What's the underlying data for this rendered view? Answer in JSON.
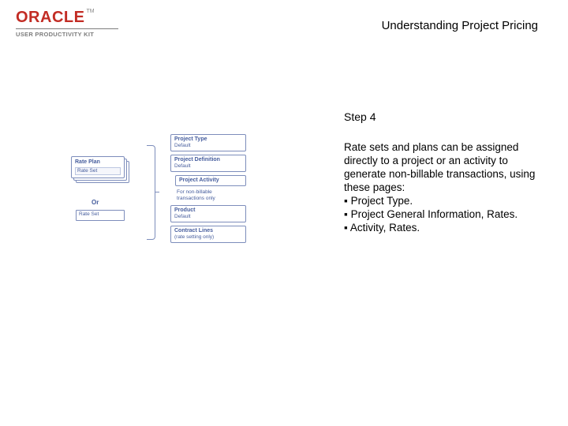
{
  "header": {
    "brand": "ORACLE",
    "tm": "TM",
    "subtitle": "USER PRODUCTIVITY KIT",
    "page_title": "Understanding Project Pricing"
  },
  "step": {
    "label": "Step 4"
  },
  "body": {
    "intro": "Rate sets and plans can be assigned directly to a project or an activity to generate non-billable transactions, using these pages:",
    "bullets": [
      "Project Type.",
      "Project General Information, Rates.",
      "Activity, Rates."
    ],
    "bullet_glyph": "▪"
  },
  "diagram": {
    "left_card_title": "Rate Plan",
    "left_card_row": "Rate Set",
    "or": "Or",
    "left_single": "Rate Set",
    "right_nodes": [
      {
        "title": "Project Type",
        "sub": "Default",
        "indent": false
      },
      {
        "title": "Project Definition",
        "sub": "Default",
        "indent": false
      },
      {
        "title": "Project Activity",
        "sub": "",
        "indent": true
      }
    ],
    "note_lines": [
      "For non-billable",
      "transactions only"
    ],
    "right_nodes2": [
      {
        "title": "Product",
        "sub": "Default",
        "indent": false
      },
      {
        "title": "Contract Lines",
        "sub": "(rate setting only)",
        "indent": false
      }
    ]
  }
}
